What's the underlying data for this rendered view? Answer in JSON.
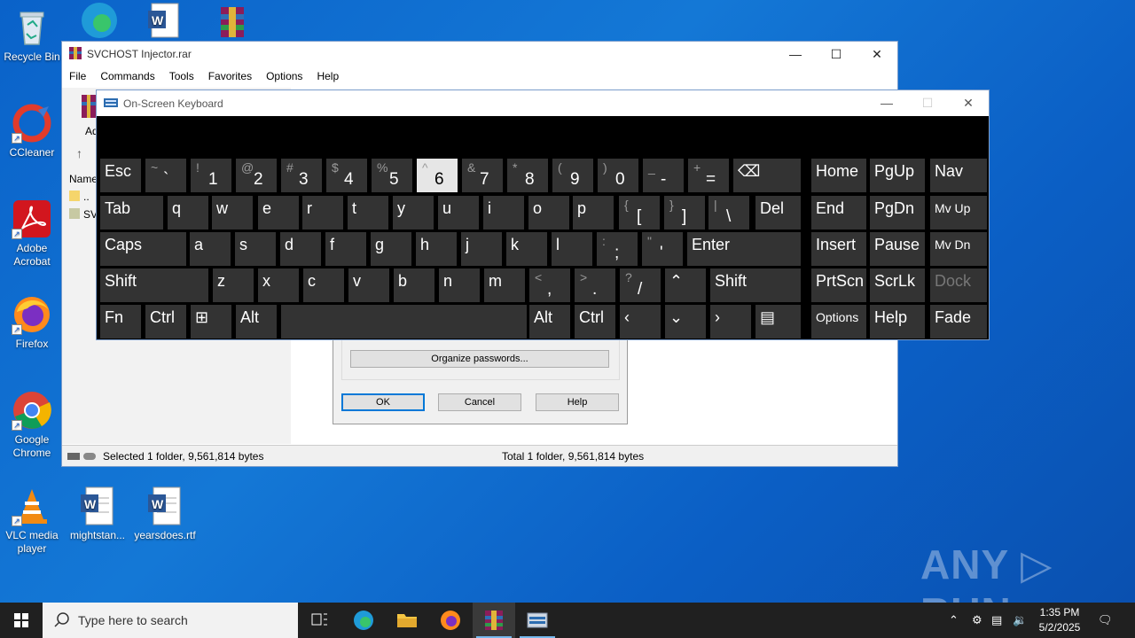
{
  "desktop": {
    "icons": [
      {
        "label": "Recycle Bin"
      },
      {
        "label": "CCleaner"
      },
      {
        "label": "Adobe Acrobat"
      },
      {
        "label": "Firefox"
      },
      {
        "label": "Google Chrome"
      },
      {
        "label": "VLC media player"
      },
      {
        "label": "mightstan..."
      },
      {
        "label": "yearsdoes.rtf"
      }
    ]
  },
  "rar_window": {
    "title": "SVCHOST Injector.rar",
    "menu": [
      "File",
      "Commands",
      "Tools",
      "Favorites",
      "Options",
      "Help"
    ],
    "toolbar_partial_label": "Ad",
    "column_name_partial": "Name",
    "rows": [
      ".. ",
      "SV"
    ],
    "status_selected": "Selected 1 folder, 9,561,814 bytes",
    "status_total": "Total 1 folder, 9,561,814 bytes"
  },
  "password_dialog": {
    "organize_label": "Organize passwords...",
    "ok_label": "OK",
    "cancel_label": "Cancel",
    "help_label": "Help"
  },
  "osk": {
    "title": "On-Screen Keyboard",
    "row1": [
      {
        "main": "Esc"
      },
      {
        "up": "~",
        "lo": "`"
      },
      {
        "up": "!",
        "lo": "1"
      },
      {
        "up": "@",
        "lo": "2"
      },
      {
        "up": "#",
        "lo": "3"
      },
      {
        "up": "$",
        "lo": "4"
      },
      {
        "up": "%",
        "lo": "5"
      },
      {
        "up": "^",
        "lo": "6",
        "selected": true
      },
      {
        "up": "&",
        "lo": "7"
      },
      {
        "up": "*",
        "lo": "8"
      },
      {
        "up": "(",
        "lo": "9"
      },
      {
        "up": ")",
        "lo": "0"
      },
      {
        "up": "_",
        "lo": "-"
      },
      {
        "up": "+",
        "lo": "="
      },
      {
        "main": "⌫"
      },
      {
        "main": "Home"
      },
      {
        "main": "PgUp"
      },
      {
        "main": "Nav"
      }
    ],
    "row2": [
      {
        "main": "Tab"
      },
      {
        "main": "q"
      },
      {
        "main": "w"
      },
      {
        "main": "e"
      },
      {
        "main": "r"
      },
      {
        "main": "t"
      },
      {
        "main": "y"
      },
      {
        "main": "u"
      },
      {
        "main": "i"
      },
      {
        "main": "o"
      },
      {
        "main": "p"
      },
      {
        "up": "{",
        "lo": "["
      },
      {
        "up": "}",
        "lo": "]"
      },
      {
        "up": "|",
        "lo": "\\"
      },
      {
        "main": "Del"
      },
      {
        "main": "End"
      },
      {
        "main": "PgDn"
      },
      {
        "main": "Mv Up"
      }
    ],
    "row3": [
      {
        "main": "Caps"
      },
      {
        "main": "a"
      },
      {
        "main": "s"
      },
      {
        "main": "d"
      },
      {
        "main": "f"
      },
      {
        "main": "g"
      },
      {
        "main": "h"
      },
      {
        "main": "j"
      },
      {
        "main": "k"
      },
      {
        "main": "l"
      },
      {
        "up": ":",
        "lo": ";"
      },
      {
        "up": "\"",
        "lo": "'"
      },
      {
        "main": "Enter"
      },
      {
        "main": "Insert"
      },
      {
        "main": "Pause"
      },
      {
        "main": "Mv Dn"
      }
    ],
    "row4": [
      {
        "main": "Shift"
      },
      {
        "main": "z"
      },
      {
        "main": "x"
      },
      {
        "main": "c"
      },
      {
        "main": "v"
      },
      {
        "main": "b"
      },
      {
        "main": "n"
      },
      {
        "main": "m"
      },
      {
        "up": "<",
        "lo": ","
      },
      {
        "up": ">",
        "lo": "."
      },
      {
        "up": "?",
        "lo": "/"
      },
      {
        "main": "⌃"
      },
      {
        "main": "Shift"
      },
      {
        "main": "PrtScn"
      },
      {
        "main": "ScrLk"
      },
      {
        "main": "Dock"
      }
    ],
    "row5": [
      {
        "main": "Fn"
      },
      {
        "main": "Ctrl"
      },
      {
        "main": "⊞"
      },
      {
        "main": "Alt"
      },
      {
        "main": ""
      },
      {
        "main": "Alt"
      },
      {
        "main": "Ctrl"
      },
      {
        "main": "‹"
      },
      {
        "main": "⌄"
      },
      {
        "main": "›"
      },
      {
        "main": "▤"
      },
      {
        "main": "Options"
      },
      {
        "main": "Help"
      },
      {
        "main": "Fade"
      }
    ]
  },
  "watermark": "ANY ▷ RUN",
  "taskbar": {
    "search_placeholder": "Type here to search",
    "time": "1:35 PM",
    "date": "5/2/2025"
  },
  "colors": {
    "key_bg": "#333333",
    "key_selected": "#e6e6e6",
    "osk_bg": "#000000",
    "taskbar_bg": "#202020",
    "desktop_blue": "#1478d6"
  }
}
